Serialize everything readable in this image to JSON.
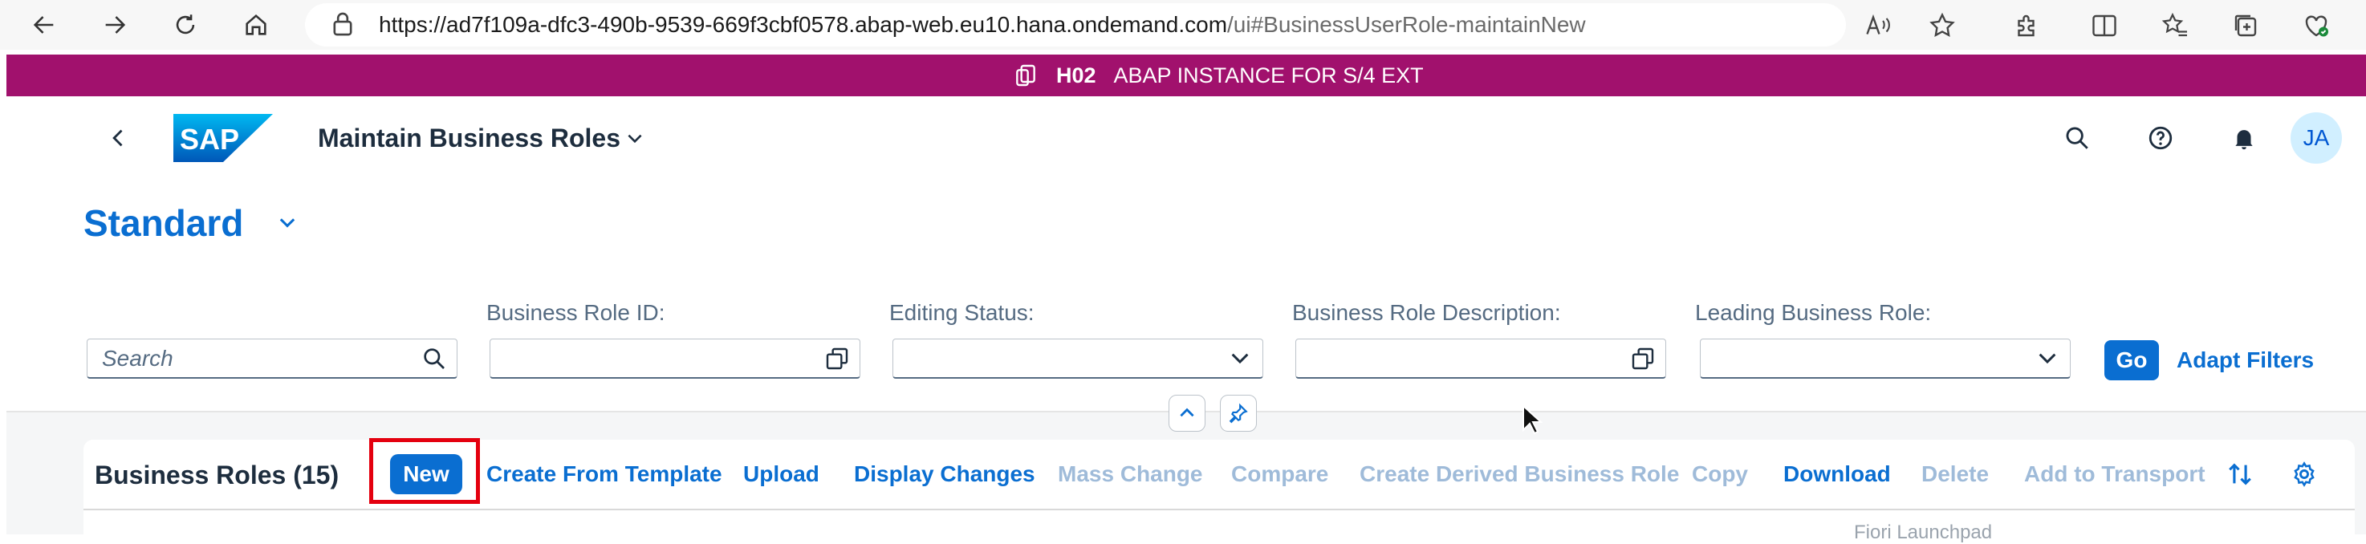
{
  "browser": {
    "url_base": "https://ad7f109a-dfc3-490b-9539-669f3cbf0578.abap-web.eu10.hana.ondemand.com",
    "url_path": "/ui#BusinessUserRole-maintainNew"
  },
  "banner": {
    "system": "H02",
    "description": "ABAP INSTANCE FOR S/4 EXT"
  },
  "shell": {
    "app_title": "Maintain Business Roles",
    "avatar_initials": "JA"
  },
  "variant": {
    "title": "Standard"
  },
  "filters": {
    "search_placeholder": "Search",
    "business_role_id_label": "Business Role ID:",
    "editing_status_label": "Editing Status:",
    "description_label": "Business Role Description:",
    "leading_role_label": "Leading Business Role:",
    "go_label": "Go",
    "adapt_label": "Adapt Filters"
  },
  "table": {
    "title": "Business Roles (15)",
    "toolbar": {
      "new": "New",
      "create_from_template": "Create From Template",
      "upload": "Upload",
      "display_changes": "Display Changes",
      "mass_change": "Mass Change",
      "compare": "Compare",
      "create_derived": "Create Derived Business Role",
      "copy": "Copy",
      "download": "Download",
      "delete": "Delete",
      "add_to_transport": "Add to Transport"
    }
  },
  "tooltip": "Fiori Launchpad",
  "colors": {
    "banner": "#a1116d",
    "accent": "#0a6ed1",
    "disabled": "#9fbbd9",
    "highlight": "#e4000f"
  }
}
